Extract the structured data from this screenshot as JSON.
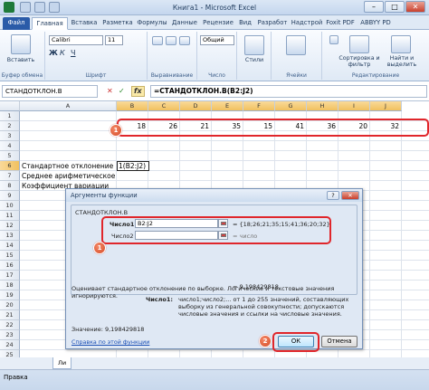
{
  "window": {
    "title": "Книга1 - Microsoft Excel",
    "min": "–",
    "max": "□",
    "close": "✕"
  },
  "ribbon_tabs": [
    "Файл",
    "Главная",
    "Вставка",
    "Разметка",
    "Формулы",
    "Данные",
    "Рецензие",
    "Вид",
    "Разработ",
    "Надстрой",
    "Foxit PDF",
    "ABBYY PD"
  ],
  "ribbon": {
    "paste": "Вставить",
    "clipboard": "Буфер обмена",
    "font": "Шрифт",
    "font_name": "Calibri",
    "font_size": "11",
    "alignment": "Выравнивание",
    "number": "Число",
    "number_format": "Общий",
    "styles": "Стили",
    "cells": "Ячейки",
    "sort": "Сортировка и фильтр",
    "find": "Найти и выделить",
    "editing": "Редактирование"
  },
  "formula_bar": {
    "name_box": "СТАНДОТКЛОН.В",
    "fx": "fx",
    "formula": "=СТАНДОТКЛОН.В(B2:J2)"
  },
  "grid": {
    "columns": [
      "A",
      "B",
      "C",
      "D",
      "E",
      "F",
      "G",
      "H",
      "I",
      "J"
    ],
    "rows": [
      "1",
      "2",
      "3",
      "4",
      "5",
      "6",
      "7",
      "8",
      "9",
      "10",
      "11",
      "12",
      "13",
      "14",
      "15",
      "16",
      "17",
      "18",
      "19",
      "20",
      "21",
      "22",
      "23",
      "24",
      "25"
    ],
    "row2_values": [
      "18",
      "26",
      "21",
      "35",
      "15",
      "41",
      "36",
      "20",
      "32"
    ],
    "label_row6": "Стандартное отклонение",
    "formula_row6": "1(B2:J2)",
    "label_row7": "Среднее арифметическое",
    "label_row8": "Коэффициент вариации"
  },
  "badges": [
    "1",
    "1",
    "2"
  ],
  "dialog": {
    "title": "Аргументы функции",
    "help": "?",
    "close": "✕",
    "function_name": "СТАНДОТКЛОН.В",
    "arg1_label": "Число1",
    "arg1_value": "B2:J2",
    "arg1_result": "= {18;26;21;35;15;41;36;20;32}",
    "arg2_label": "Число2",
    "arg2_value": "",
    "arg2_result": "= число",
    "result_line": "= 9,198429818",
    "description": "Оценивает стандартное отклонение по выборке. Логические и текстовые значения игнорируются.",
    "arg_help_label": "Число1:",
    "arg_help_text": "число1;число2;... от 1 до 255 значений, составляющих выборку из генеральной совокупности; допускаются числовые значения и ссылки на числовые значения.",
    "value_label": "Значение:  9,198429818",
    "help_link": "Справка по этой функции",
    "ok": "ОК",
    "cancel": "Отмена"
  },
  "status": {
    "mode": "Правка",
    "sheet": "Ли"
  },
  "colors": {
    "accent": "#2a5ba8",
    "highlight_red": "#e0262b",
    "badge": "#d44a24"
  }
}
